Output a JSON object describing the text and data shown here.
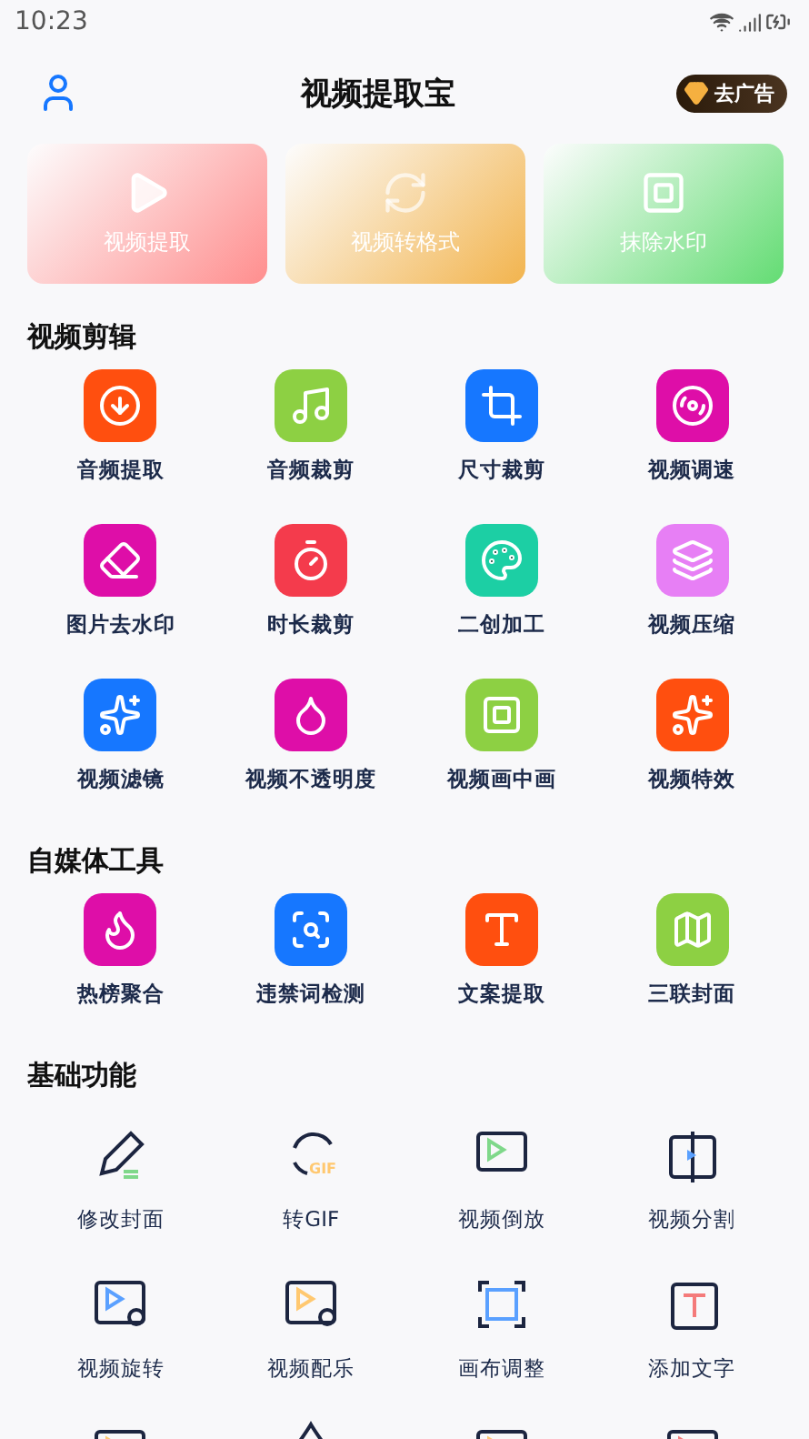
{
  "status_bar": {
    "time": "10:23"
  },
  "header": {
    "title": "视频提取宝",
    "ad_button": "去广告"
  },
  "feature_cards": [
    {
      "label": "视频提取",
      "color": "#ff8e8e"
    },
    {
      "label": "视频转格式",
      "color": "#f2b44e"
    },
    {
      "label": "抹除水印",
      "color": "#63dc73"
    }
  ],
  "sections": [
    {
      "title": "视频剪辑",
      "kind": "colored",
      "items": [
        {
          "label": "音频提取",
          "color": "#ff4f0f"
        },
        {
          "label": "音频裁剪",
          "color": "#8dd043"
        },
        {
          "label": "尺寸裁剪",
          "color": "#1677ff"
        },
        {
          "label": "视频调速",
          "color": "#de0ea8"
        },
        {
          "label": "图片去水印",
          "color": "#de0ea8"
        },
        {
          "label": "时长裁剪",
          "color": "#f43b4c"
        },
        {
          "label": "二创加工",
          "color": "#1ccfa4"
        },
        {
          "label": "视频压缩",
          "color": "#e77ff5"
        },
        {
          "label": "视频滤镜",
          "color": "#1677ff"
        },
        {
          "label": "视频不透明度",
          "color": "#de0ea8"
        },
        {
          "label": "视频画中画",
          "color": "#8dd043"
        },
        {
          "label": "视频特效",
          "color": "#ff4f0f"
        }
      ]
    },
    {
      "title": "自媒体工具",
      "kind": "colored",
      "items": [
        {
          "label": "热榜聚合",
          "color": "#de0ea8"
        },
        {
          "label": "违禁词检测",
          "color": "#1677ff"
        },
        {
          "label": "文案提取",
          "color": "#ff4f0f"
        },
        {
          "label": "三联封面",
          "color": "#8dd043"
        }
      ]
    },
    {
      "title": "基础功能",
      "kind": "outline",
      "items": [
        {
          "kind": "tool",
          "label": "修改封面"
        },
        {
          "kind": "tool",
          "label": "转GIF",
          "badge": "GIF"
        },
        {
          "kind": "tool",
          "label": "视频倒放"
        },
        {
          "kind": "tool",
          "label": "视频分割"
        },
        {
          "kind": "tool",
          "label": "视频旋转"
        },
        {
          "kind": "tool",
          "label": "视频配乐"
        },
        {
          "kind": "tool",
          "label": "画布调整"
        },
        {
          "kind": "tool",
          "label": "添加文字"
        },
        {
          "kind": "cut"
        },
        {
          "kind": "cut"
        },
        {
          "kind": "cut"
        },
        {
          "kind": "cut"
        }
      ]
    }
  ]
}
